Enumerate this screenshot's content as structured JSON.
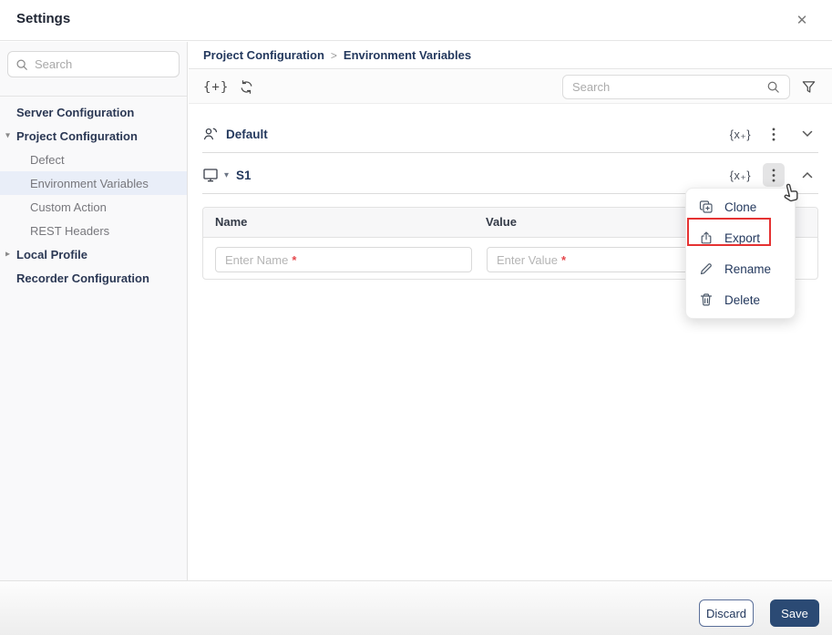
{
  "window": {
    "title": "Settings"
  },
  "icons": {
    "close": "✕",
    "add_variables": "{+}",
    "variable_badge": "{x₊}",
    "caret_expanded": "▾",
    "caret_collapsed": "▸",
    "breadcrumb_separator": ">"
  },
  "sidebar": {
    "search_placeholder": "Search",
    "items": [
      {
        "label": "Server Configuration",
        "type": "group"
      },
      {
        "label": "Project Configuration",
        "type": "group",
        "state": "expanded"
      },
      {
        "label": "Defect",
        "type": "child"
      },
      {
        "label": "Environment Variables",
        "type": "child",
        "selected": true
      },
      {
        "label": "Custom Action",
        "type": "child"
      },
      {
        "label": "REST Headers",
        "type": "child"
      },
      {
        "label": "Local Profile",
        "type": "group",
        "state": "collapsed"
      },
      {
        "label": "Recorder Configuration",
        "type": "group"
      }
    ]
  },
  "breadcrumb": {
    "parent": "Project Configuration",
    "current": "Environment Variables"
  },
  "toolbar": {
    "search_placeholder": "Search"
  },
  "sections": {
    "default": {
      "name": "Default",
      "state": "collapsed"
    },
    "s1": {
      "name": "S1",
      "state": "expanded"
    }
  },
  "table": {
    "columns": {
      "name": "Name",
      "value": "Value"
    },
    "new_row": {
      "name_placeholder": "Enter Name",
      "value_placeholder": "Enter Value",
      "required_marker": "*"
    }
  },
  "context_menu": {
    "items": [
      {
        "label": "Clone"
      },
      {
        "label": "Export",
        "highlighted": true
      },
      {
        "label": "Rename"
      },
      {
        "label": "Delete"
      }
    ]
  },
  "footer": {
    "discard": "Discard",
    "save": "Save"
  },
  "colors": {
    "navy": "#24395e",
    "save-bg": "#2b4a74",
    "selected-bg": "#e9eef8",
    "highlight-red": "#e53232",
    "required-red": "#e5484d"
  }
}
